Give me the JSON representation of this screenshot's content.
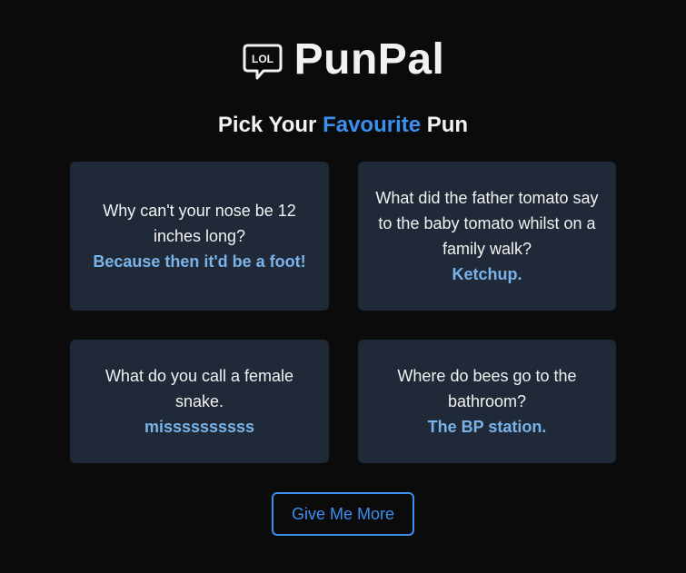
{
  "app": {
    "title": "PunPal",
    "logo_icon": "lol-speech-bubble-icon",
    "logo_text": "LOL"
  },
  "heading": {
    "prefix": "Pick Your ",
    "accent": "Favourite",
    "suffix": " Pun",
    "accent_color": "#3b8ff0"
  },
  "puns": [
    {
      "question": "Why can't your nose be 12 inches long?",
      "answer": "Because then it'd be a foot!"
    },
    {
      "question": "What did the father tomato say to the baby tomato whilst on a family walk?",
      "answer": "Ketchup."
    },
    {
      "question": "What do you call a female snake.",
      "answer": "missssssssss"
    },
    {
      "question": "Where do bees go to the bathroom?",
      "answer": "The BP station."
    }
  ],
  "actions": {
    "more_label": "Give Me More"
  },
  "colors": {
    "background": "#0b0b0c",
    "card": "#1f2937",
    "answer": "#7ab3ea",
    "accent": "#3b8ff0"
  }
}
